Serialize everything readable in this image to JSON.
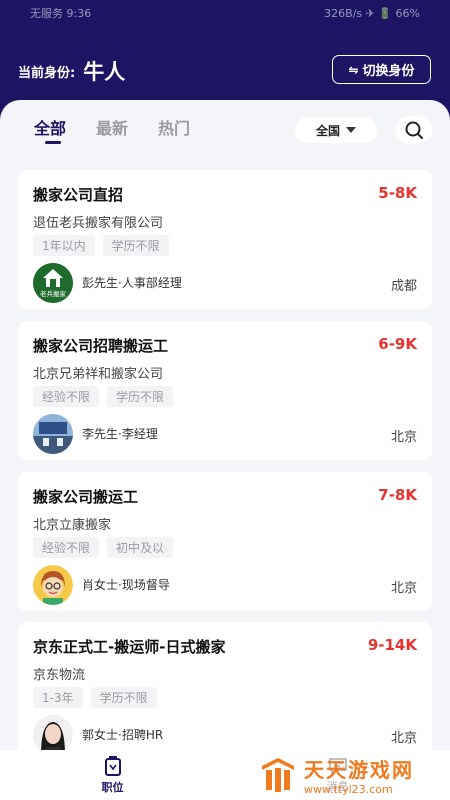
{
  "status_bar": {
    "left": "无服务 9:36",
    "right": "326B/s ✈ 🔋 66%"
  },
  "header": {
    "identity_label": "当前身份:",
    "identity_value": "牛人",
    "switch_label": "切换身份"
  },
  "tabs": [
    {
      "label": "全部",
      "active": true
    },
    {
      "label": "最新",
      "active": false
    },
    {
      "label": "热门",
      "active": false
    }
  ],
  "region_select": {
    "value": "全国"
  },
  "jobs": [
    {
      "title": "搬家公司直招",
      "salary": "5-8K",
      "company": "退伍老兵搬家有限公司",
      "tags": [
        "1年以内",
        "学历不限"
      ],
      "recruiter": "彭先生·人事部经理",
      "city": "成都",
      "avatar_logo": "老兵搬家"
    },
    {
      "title": "搬家公司招聘搬运工",
      "salary": "6-9K",
      "company": "北京兄弟祥和搬家公司",
      "tags": [
        "经验不限",
        "学历不限"
      ],
      "recruiter": "李先生·李经理",
      "city": "北京",
      "avatar_logo": ""
    },
    {
      "title": "搬家公司搬运工",
      "salary": "7-8K",
      "company": "北京立康搬家",
      "tags": [
        "经验不限",
        "初中及以"
      ],
      "recruiter": "肖女士·现场督导",
      "city": "北京",
      "avatar_logo": ""
    },
    {
      "title": "京东正式工-搬运师-日式搬家",
      "salary": "9-14K",
      "company": "京东物流",
      "tags": [
        "1-3年",
        "学历不限"
      ],
      "recruiter": "郭女士·招聘HR",
      "city": "北京",
      "avatar_logo": ""
    }
  ],
  "bottom_nav": [
    {
      "label": "职位",
      "active": true,
      "icon": "job-icon"
    },
    {
      "label": "消息",
      "active": false,
      "icon": "message-icon"
    }
  ],
  "watermark": {
    "big": "天天游戏网",
    "small": "www.ttyl23.com"
  },
  "colors": {
    "brand": "#1d1464",
    "salary": "#e8322f",
    "watermark": "#f07a1e"
  }
}
